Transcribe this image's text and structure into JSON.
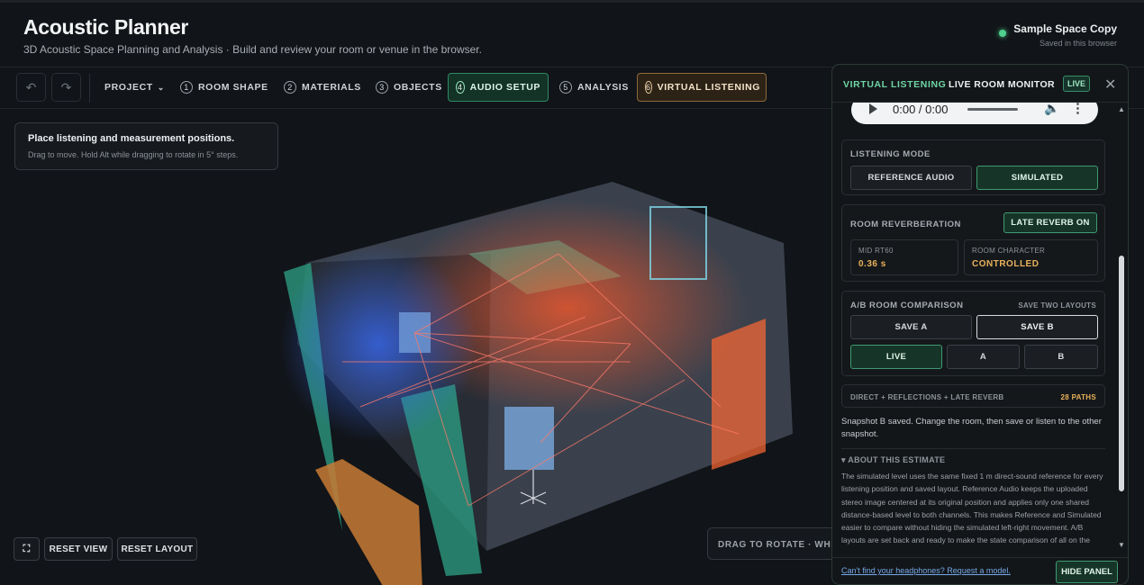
{
  "app": {
    "title": "Acoustic Planner",
    "subtitle": "3D Acoustic Space Planning and Analysis · Build and review your room or venue in the browser."
  },
  "project": {
    "name": "Sample Space Copy",
    "status": "Saved in this browser"
  },
  "toolbar": {
    "project_label": "PROJECT",
    "steps": [
      {
        "num": "1",
        "label": "ROOM SHAPE"
      },
      {
        "num": "2",
        "label": "MATERIALS"
      },
      {
        "num": "3",
        "label": "OBJECTS"
      },
      {
        "num": "4",
        "label": "AUDIO SETUP"
      },
      {
        "num": "5",
        "label": "ANALYSIS"
      },
      {
        "num": "6",
        "label": "VIRTUAL LISTENING"
      }
    ]
  },
  "hint": {
    "title": "Place listening and measurement positions.",
    "sub": "Drag to move. Hold Alt while dragging to rotate in 5° steps."
  },
  "viewport": {
    "reset_view": "RESET VIEW",
    "reset_layout": "RESET LAYOUT",
    "drag_hint": "DRAG TO ROTATE · WHEEL"
  },
  "panel": {
    "title_accent": "VIRTUAL LISTENING",
    "title": "LIVE ROOM MONITOR",
    "live_badge": "LIVE",
    "audio_time": "0:00 / 0:00",
    "listening_mode": {
      "label": "LISTENING MODE",
      "reference": "REFERENCE AUDIO",
      "simulated": "SIMULATED"
    },
    "reverb": {
      "label": "ROOM REVERBERATION",
      "toggle": "LATE REVERB ON",
      "rt60_label": "MID RT60",
      "rt60_value": "0.36 s",
      "character_label": "ROOM CHARACTER",
      "character_value": "CONTROLLED"
    },
    "ab": {
      "label": "A/B ROOM COMPARISON",
      "hint": "SAVE TWO LAYOUTS",
      "save_a": "SAVE A",
      "save_b": "SAVE B",
      "live": "LIVE",
      "a": "A",
      "b": "B"
    },
    "paths": {
      "label": "DIRECT + REFLECTIONS + LATE REVERB",
      "count": "28 PATHS"
    },
    "message": "Snapshot B saved. Change the room, then save or listen to the other snapshot.",
    "about": {
      "label": "▾ ABOUT THIS ESTIMATE",
      "text": "The simulated level uses the same fixed 1 m direct-sound reference for every listening position and saved layout. Reference Audio keeps the uploaded stereo image centered at its original position and applies only one shared distance-based level to both channels. This makes Reference and Simulated easier to compare without hiding the simulated left-right movement. A/B layouts are set back and ready to make the state comparison of all on the"
    },
    "footer": {
      "link": "Can't find your headphones? Request a model.",
      "hide": "HIDE PANEL"
    }
  },
  "colors": {
    "accent": "#3e9a72",
    "live_text": "#6ed5a4",
    "warm_value": "#e9b25a",
    "status_dot": "#4fd18f"
  }
}
